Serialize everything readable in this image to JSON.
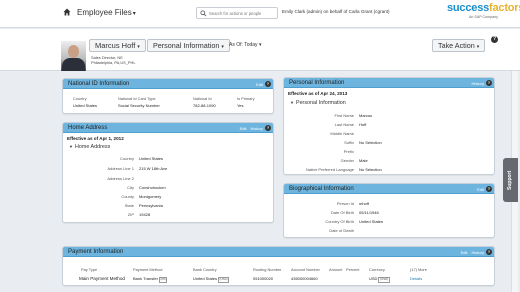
{
  "topbar": {
    "module": "Employee Files",
    "search_placeholder": "Search for actions or people",
    "user": "Emily Clark (admin) on behalf of Carla Grant (cgrant)",
    "brand_main": "success",
    "brand_accent": "factors",
    "brand_sub": "An SAP Company"
  },
  "header": {
    "employee": "Marcus Hoff",
    "view": "Personal Information",
    "as_of": "As Of: Today",
    "title_line": "Sales Director, NE",
    "location_line": "Philadelphia, PA,US_PHL",
    "take_action": "Take Action"
  },
  "national_id": {
    "title": "National ID Information",
    "edit": "Edit",
    "headers": [
      "Country",
      "National Id Card Type",
      "National Id",
      "Is Primary"
    ],
    "row": [
      "United States",
      "Social Security Number",
      "782-88-1090",
      "Yes"
    ]
  },
  "home_address": {
    "title": "Home Address",
    "edit": "Edit",
    "history": "History",
    "effective": "Effective as of Apr 1, 2012",
    "section": "Home Address",
    "fields": [
      {
        "label": "Country",
        "value": "United States"
      },
      {
        "label": "Address Line 1",
        "value": "215 W 18th Ave"
      },
      {
        "label": "Address Line 2",
        "value": ""
      },
      {
        "label": "City",
        "value": "Conshohocken"
      },
      {
        "label": "County",
        "value": "Montgomery"
      },
      {
        "label": "State",
        "value": "Pennsylvania"
      },
      {
        "label": "ZIP",
        "value": "19428"
      }
    ]
  },
  "personal_info": {
    "title": "Personal Information",
    "history": "History",
    "effective": "Effective as of Apr 24, 2013",
    "section": "Personal Information",
    "fields": [
      {
        "label": "First Name",
        "value": "Marcus"
      },
      {
        "label": "Last Name",
        "value": "Hoff"
      },
      {
        "label": "Middle Name",
        "value": ""
      },
      {
        "label": "Suffix",
        "value": "No Selection"
      },
      {
        "label": "Prefix",
        "value": ""
      },
      {
        "label": "Gender",
        "value": "Male"
      },
      {
        "label": "Native Preferred Language",
        "value": "No Selection"
      }
    ]
  },
  "biographical": {
    "title": "Biographical Information",
    "edit": "Edit",
    "fields": [
      {
        "label": "Person Id",
        "value": "mhoff"
      },
      {
        "label": "Date Of Birth",
        "value": "05/11/1946"
      },
      {
        "label": "Country Of Birth",
        "value": "United States"
      },
      {
        "label": "Date of Death",
        "value": ""
      }
    ]
  },
  "payment": {
    "title": "Payment Information",
    "edit": "Edit",
    "history": "History",
    "headers": [
      "Pay Type",
      "Payment Method",
      "Bank Country",
      "Routing Number",
      "Account Number",
      "Amount",
      "Percent",
      "Currency",
      "(17) More"
    ],
    "row": {
      "pay_type": "Main Payment Method",
      "method": "Bank Transfer",
      "method_code": "(05)",
      "bank_country": "United States",
      "bank_country_code": "(USA)",
      "routing": "051000020",
      "account": "435000004660",
      "amount": "",
      "percent": "",
      "currency": "USD",
      "currency_code": "(USD)",
      "details": "Details"
    }
  },
  "support": "Support",
  "colors": {
    "panel_header": "#6db5df",
    "brand_blue": "#1a8ecb",
    "brand_gold": "#e9b32b",
    "link": "#1a78b8"
  }
}
